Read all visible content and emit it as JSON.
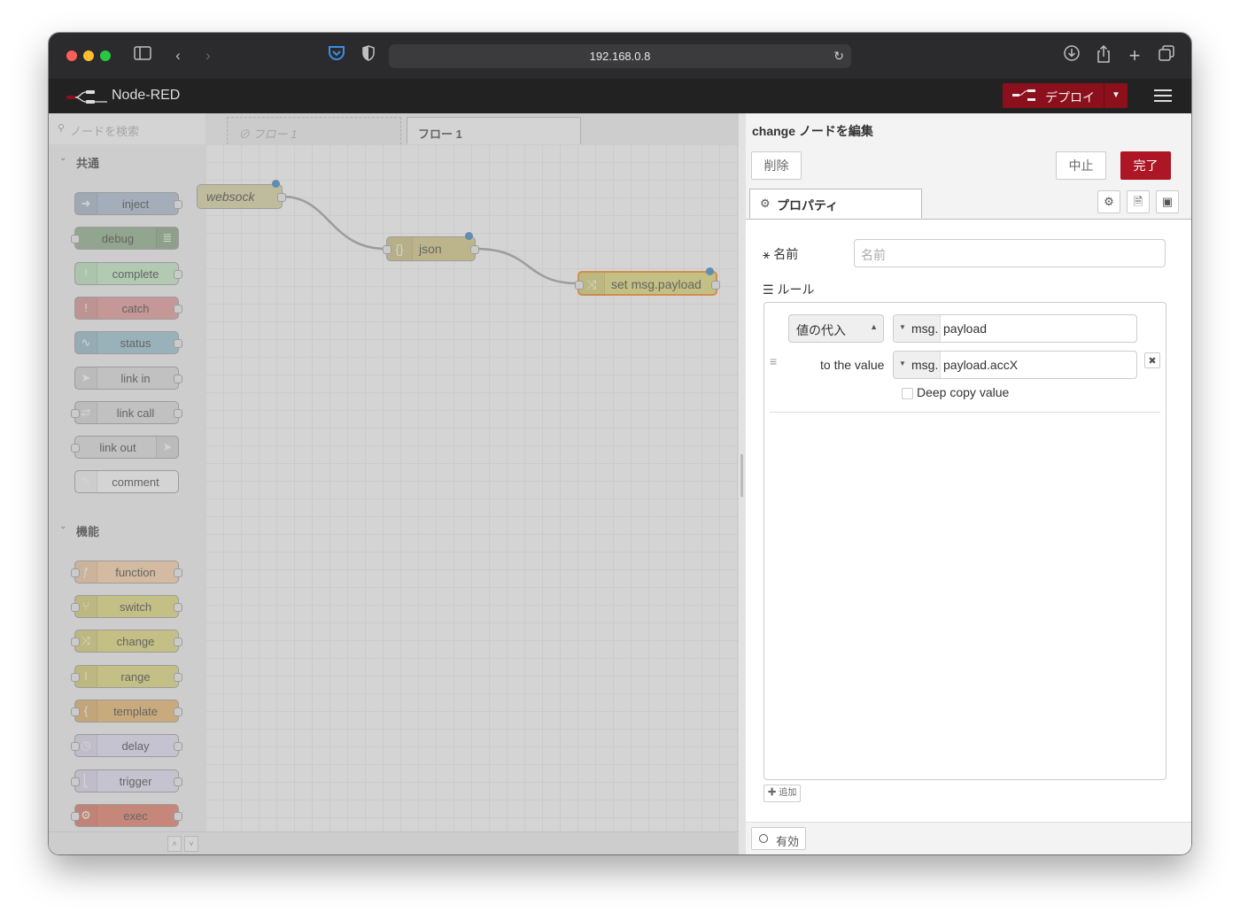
{
  "browser": {
    "url": "192.168.0.8",
    "traffic_lights": [
      "#ff5f57",
      "#febc2e",
      "#28c840"
    ]
  },
  "header": {
    "title": "Node-RED",
    "deploy_label": "デプロイ",
    "deploy_color": "#8c101c"
  },
  "palette": {
    "search_placeholder": "ノードを検索",
    "categories": [
      {
        "name": "共通",
        "nodes": [
          {
            "label": "inject",
            "color": "#a6bbcf",
            "icon": "arrow-right-icon"
          },
          {
            "label": "debug",
            "color": "#87a980",
            "icon": "list-icon"
          },
          {
            "label": "complete",
            "color": "#c0edc0",
            "icon": "exclamation-icon"
          },
          {
            "label": "catch",
            "color": "#e49191",
            "icon": "exclamation-icon"
          },
          {
            "label": "status",
            "color": "#94c1d0",
            "icon": "pulse-icon"
          },
          {
            "label": "link in",
            "color": "#dddddd",
            "icon": "link-in-icon"
          },
          {
            "label": "link call",
            "color": "#dddddd",
            "icon": "link-call-icon"
          },
          {
            "label": "link out",
            "color": "#dddddd",
            "icon": "link-out-icon"
          },
          {
            "label": "comment",
            "color": "#ffffff",
            "icon": "comment-icon"
          }
        ]
      },
      {
        "name": "機能",
        "nodes": [
          {
            "label": "function",
            "color": "#fdd0a2",
            "icon": "function-icon"
          },
          {
            "label": "switch",
            "color": "#e2d96e",
            "icon": "switch-icon"
          },
          {
            "label": "change",
            "color": "#e2d96e",
            "icon": "shuffle-icon"
          },
          {
            "label": "range",
            "color": "#e2d96e",
            "icon": "range-icon"
          },
          {
            "label": "template",
            "color": "#ebb35f",
            "icon": "brace-icon"
          },
          {
            "label": "delay",
            "color": "#e6e0f8",
            "icon": "timer-icon"
          },
          {
            "label": "trigger",
            "color": "#e6e0f8",
            "icon": "trigger-icon"
          },
          {
            "label": "exec",
            "color": "#e5745b",
            "icon": "gear-icon"
          }
        ]
      }
    ]
  },
  "workspace": {
    "tabs": [
      {
        "label": "⊘ フロー 1",
        "disabled": true
      },
      {
        "label": "フロー 1",
        "active": true
      }
    ],
    "nodes": [
      {
        "label": "websock",
        "color": "#d8d39a"
      },
      {
        "label": "json",
        "color": "#d4c77b"
      },
      {
        "label": "set msg.payload",
        "color": "#e2d96e"
      }
    ]
  },
  "editor": {
    "title": "change ノードを編集",
    "delete_label": "削除",
    "cancel_label": "中止",
    "done_label": "完了",
    "tab_label": "プロパティ",
    "name_label": "名前",
    "name_placeholder": "名前",
    "rules_label": "ルール",
    "rule": {
      "action": "値の代入",
      "target_type": "msg.",
      "target_value": "payload",
      "to_label": "to the value",
      "source_type": "msg.",
      "source_value": "payload.accX",
      "deep_copy_label": "Deep copy value",
      "deep_copy_checked": false
    },
    "add_label": "✚ 追加",
    "enabled_label": "有効"
  }
}
